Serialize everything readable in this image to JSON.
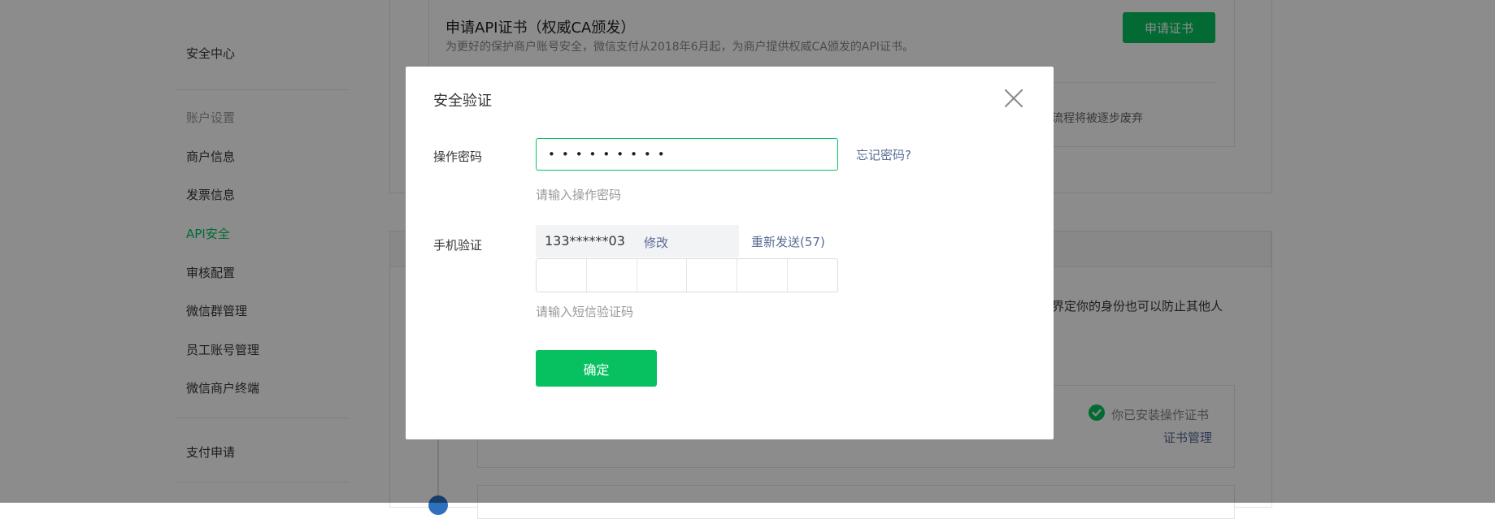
{
  "sidebar": {
    "items": [
      {
        "label": "安全中心",
        "kind": "item"
      },
      {
        "label": "账户设置",
        "kind": "group"
      },
      {
        "label": "商户信息",
        "kind": "item"
      },
      {
        "label": "发票信息",
        "kind": "item"
      },
      {
        "label": "API安全",
        "kind": "active"
      },
      {
        "label": "审核配置",
        "kind": "item"
      },
      {
        "label": "微信群管理",
        "kind": "item"
      },
      {
        "label": "员工账号管理",
        "kind": "item"
      },
      {
        "label": "微信商户终端",
        "kind": "item"
      },
      {
        "label": "支付申请",
        "kind": "item"
      }
    ]
  },
  "background": {
    "cert_title": "申请API证书（权威CA颁发）",
    "cert_desc": "为更好的保护商户账号安全，微信支付从2018年6月起，为商户提供权威CA颁发的API证书。",
    "apply_button": "申请证书",
    "deprecated_text": "流程将被逐步废弃",
    "identity_text": "界定你的身份也可以防止其他人",
    "installed_text": "你已安装操作证书",
    "cert_manage_link": "证书管理"
  },
  "modal": {
    "title": "安全验证",
    "password_label": "操作密码",
    "password_value": "•••••••••",
    "forgot_password": "忘记密码?",
    "password_hint": "请输入操作密码",
    "phone_label": "手机验证",
    "phone_number": "133******03",
    "modify": "修改",
    "resend": "重新发送(57)",
    "sms_hint": "请输入短信验证码",
    "confirm": "确定"
  },
  "colors": {
    "accent": "#07c160",
    "link": "#576b95",
    "overlay": "rgba(0,0,0,0.45)"
  },
  "icons": {
    "close": "close-icon",
    "check": "check-circle-icon"
  }
}
